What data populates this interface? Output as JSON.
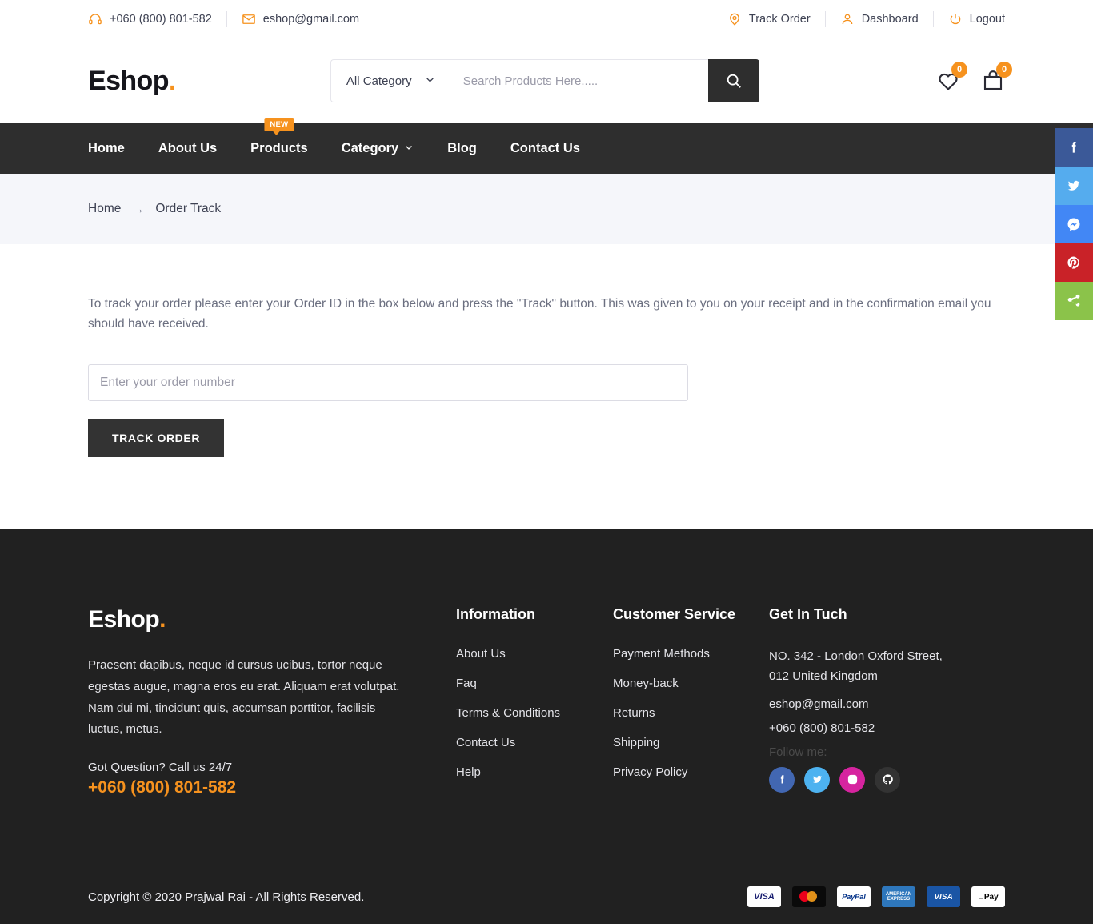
{
  "topbar": {
    "phone": "+060 (800) 801-582",
    "email": "eshop@gmail.com",
    "track_order": "Track Order",
    "dashboard": "Dashboard",
    "logout": "Logout"
  },
  "header": {
    "logo": "Eshop",
    "logo_dot": ".",
    "category_label": "All Category",
    "search_placeholder": "Search Products Here.....",
    "wishlist_count": "0",
    "cart_count": "0"
  },
  "nav": {
    "items": [
      {
        "label": "Home",
        "badge": "",
        "caret": false
      },
      {
        "label": "About Us",
        "badge": "",
        "caret": false
      },
      {
        "label": "Products",
        "badge": "NEW",
        "caret": false
      },
      {
        "label": "Category",
        "badge": "",
        "caret": true
      },
      {
        "label": "Blog",
        "badge": "",
        "caret": false
      },
      {
        "label": "Contact Us",
        "badge": "",
        "caret": false
      }
    ]
  },
  "breadcrumb": {
    "home": "Home",
    "arrow": "→",
    "current": "Order Track"
  },
  "main": {
    "description": "To track your order please enter your Order ID in the box below and press the \"Track\" button. This was given to you on your receipt and in the confirmation email you should have received.",
    "input_placeholder": "Enter your order number",
    "button_label": "TRACK ORDER"
  },
  "rail": [
    {
      "name": "facebook",
      "color": "#3b5998"
    },
    {
      "name": "twitter",
      "color": "#55acee"
    },
    {
      "name": "messenger",
      "color": "#4287f5"
    },
    {
      "name": "pinterest",
      "color": "#c92228"
    },
    {
      "name": "share",
      "color": "#8bc34a"
    }
  ],
  "footer": {
    "logo": "Eshop",
    "logo_dot": ".",
    "description": "Praesent dapibus, neque id cursus ucibus, tortor neque egestas augue, magna eros eu erat. Aliquam erat volutpat. Nam dui mi, tincidunt quis, accumsan porttitor, facilisis luctus, metus.",
    "call_label": "Got Question? Call us 24/7",
    "phone": "+060 (800) 801-582",
    "information": {
      "title": "Information",
      "links": [
        "About Us",
        "Faq",
        "Terms & Conditions",
        "Contact Us",
        "Help"
      ]
    },
    "customer_service": {
      "title": "Customer Service",
      "links": [
        "Payment Methods",
        "Money-back",
        "Returns",
        "Shipping",
        "Privacy Policy"
      ]
    },
    "contact": {
      "title": "Get In Tuch",
      "address": "NO. 342 - London Oxford Street, 012 United Kingdom",
      "email": "eshop@gmail.com",
      "phone": "+060 (800) 801-582",
      "follow_label": "Follow me:",
      "socials": [
        {
          "name": "facebook",
          "color": "#4267B2"
        },
        {
          "name": "twitter",
          "color": "#4DB2F0"
        },
        {
          "name": "instagram",
          "color": "#D6249F"
        },
        {
          "name": "github",
          "color": "#333333"
        }
      ]
    },
    "copyright_prefix": "Copyright © 2020 ",
    "copyright_author": "Prajwal Rai",
    "copyright_suffix": " - All Rights Reserved.",
    "payments": [
      "VISA",
      "Mastercard",
      "PayPal",
      "American Express",
      "VISA Electron",
      "Apple Pay"
    ]
  },
  "colors": {
    "accent": "#f6921e",
    "dark": "#2e2e2e",
    "footer_bg": "#212121",
    "breadcrumb_bg": "#f5f6fa"
  }
}
